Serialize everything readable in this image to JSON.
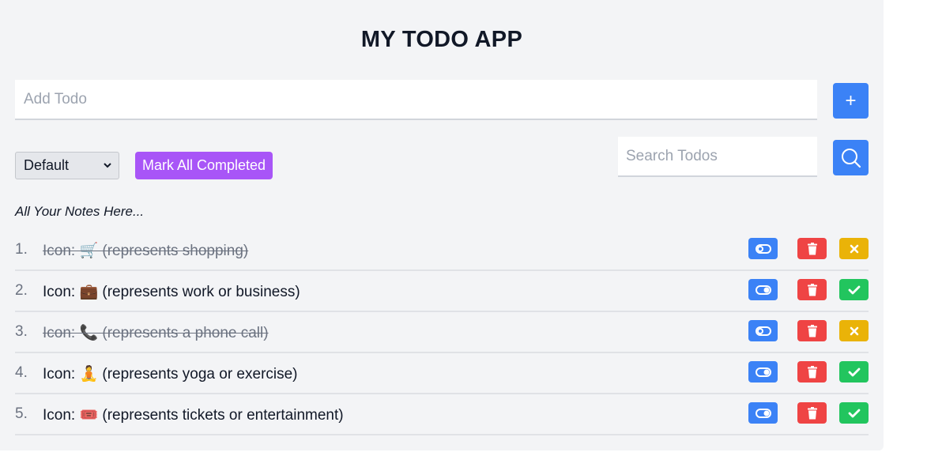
{
  "app": {
    "title": "MY TODO APP",
    "accent_color": "#3b82f6"
  },
  "add_todo": {
    "placeholder": "Add Todo",
    "value": "",
    "button_icon": "plus-icon",
    "button_label": "+"
  },
  "controls": {
    "sort_select": {
      "selected": "Default",
      "icon": "chevron-down-icon"
    },
    "mark_all_label": "Mark All Completed",
    "mark_all_color": "#a855f7",
    "search": {
      "placeholder": "Search Todos",
      "value": "",
      "button_icon": "search-icon"
    }
  },
  "notes_caption": "All Your Notes Here...",
  "todos": [
    {
      "index": "1.",
      "text": "Icon: 🛒 (represents shopping)",
      "completed": true
    },
    {
      "index": "2.",
      "text": "Icon: 💼 (represents work or business)",
      "completed": false
    },
    {
      "index": "3.",
      "text": "Icon: 📞 (represents a phone call)",
      "completed": true
    },
    {
      "index": "4.",
      "text": "Icon: 🧘 (represents yoga or exercise)",
      "completed": false
    },
    {
      "index": "5.",
      "text": "Icon: 🎟️ (represents tickets or entertainment)",
      "completed": false
    }
  ],
  "row_actions": {
    "toggle_icon": "toggle-icon",
    "delete_icon": "trash-icon",
    "complete_icon": "check-icon",
    "undo_icon": "x-icon",
    "colors": {
      "toggle": "#3b82f6",
      "delete": "#ef4444",
      "complete": "#22c55e",
      "undo": "#eab308"
    }
  }
}
